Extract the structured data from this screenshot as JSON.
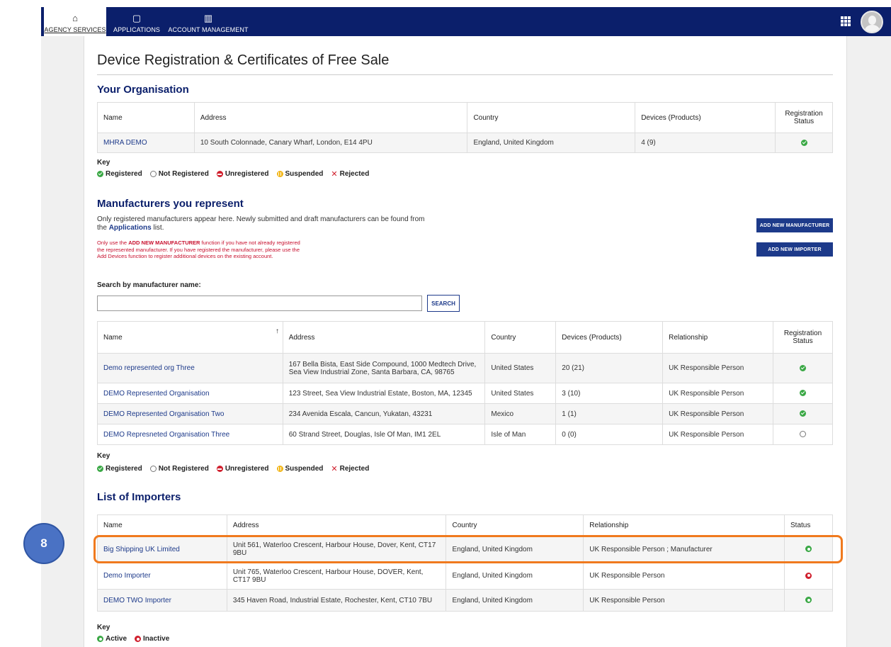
{
  "nav": {
    "items": [
      {
        "icon": "home-icon",
        "glyph": "⌂",
        "label": "AGENCY SERVICES"
      },
      {
        "icon": "document-icon",
        "glyph": "▢",
        "label": "APPLICATIONS"
      },
      {
        "icon": "building-icon",
        "glyph": "▥",
        "label": "ACCOUNT MANAGEMENT"
      }
    ],
    "apps_icon": "grid-icon",
    "avatar_icon": "user-avatar-icon"
  },
  "page": {
    "title": "Device Registration & Certificates of Free Sale"
  },
  "your_org": {
    "heading": "Your Organisation",
    "columns": [
      "Name",
      "Address",
      "Country",
      "Devices (Products)",
      "Registration Status"
    ],
    "rows": [
      {
        "name": "MHRA DEMO",
        "address": "10 South Colonnade, Canary Wharf, London, E14 4PU",
        "country": "England, United Kingdom",
        "devices": "4 (9)",
        "status": "registered"
      }
    ]
  },
  "key_registration": {
    "title": "Key",
    "items": [
      "Registered",
      "Not Registered",
      "Unregistered",
      "Suspended",
      "Rejected"
    ]
  },
  "manufacturers": {
    "heading": "Manufacturers you represent",
    "desc_line1": "Only registered manufacturers appear here. Newly submitted and draft manufacturers can be found from",
    "desc_line2_pre": "the ",
    "desc_line2_link": "Applications",
    "desc_line2_post": " list.",
    "warn_pre": "Only use the ",
    "warn_bold": "ADD NEW MANUFACTURER",
    "warn_post": " function if you have not already registered the represented manufacturer. If you have registered the manufacturer, please use the Add Devices function to register additional devices on the existing account.",
    "add_manufacturer_label": "ADD NEW MANUFACTURER",
    "add_importer_label": "ADD NEW IMPORTER",
    "search_label": "Search by manufacturer name:",
    "search_value": "",
    "search_button": "SEARCH",
    "sort_arrow": "↑",
    "columns": [
      "Name",
      "Address",
      "Country",
      "Devices (Products)",
      "Relationship",
      "Registration Status"
    ],
    "rows": [
      {
        "name": "Demo represented org Three",
        "address": "167 Bella Bista, East Side Compound, 1000 Medtech Drive, Sea View Industrial Zone, Santa Barbara, CA, 98765",
        "country": "United States",
        "devices": "20 (21)",
        "relationship": "UK Responsible Person",
        "status": "registered"
      },
      {
        "name": "DEMO Represented Organisation",
        "address": "123 Street, Sea View Industrial Estate, Boston, MA, 12345",
        "country": "United States",
        "devices": "3 (10)",
        "relationship": "UK Responsible Person",
        "status": "registered"
      },
      {
        "name": "DEMO Represented Organisation Two",
        "address": "234 Avenida Escala, Cancun, Yukatan, 43231",
        "country": "Mexico",
        "devices": "1 (1)",
        "relationship": "UK Responsible Person",
        "status": "registered"
      },
      {
        "name": "DEMO Represneted Organisation Three",
        "address": "60 Strand Street, Douglas, Isle Of Man, IM1 2EL",
        "country": "Isle of Man",
        "devices": "0 (0)",
        "relationship": "UK Responsible Person",
        "status": "not-registered"
      }
    ]
  },
  "importers": {
    "heading": "List of Importers",
    "columns": [
      "Name",
      "Address",
      "Country",
      "Relationship",
      "Status"
    ],
    "rows": [
      {
        "name": "Big Shipping UK Limited",
        "address": "Unit 561, Waterloo Crescent, Harbour House, Dover, Kent, CT17 9BU",
        "country": "England, United Kingdom",
        "relationship": "UK Responsible Person ; Manufacturer",
        "status": "active"
      },
      {
        "name": "Demo Importer",
        "address": "Unit 765, Waterloo Crescent, Harbour House, DOVER, Kent, CT17 9BU",
        "country": "England, United Kingdom",
        "relationship": "UK Responsible Person",
        "status": "inactive"
      },
      {
        "name": "DEMO TWO Importer",
        "address": "345 Haven Road, Industrial Estate, Rochester, Kent, CT10 7BU",
        "country": "England, United Kingdom",
        "relationship": "UK Responsible Person",
        "status": "active"
      }
    ]
  },
  "key_importer": {
    "title": "Key",
    "items": [
      "Active",
      "Inactive"
    ]
  },
  "annotation": {
    "step_number": "8",
    "highlight_color": "#f07a1e",
    "badge_color": "#4a72c4"
  },
  "colors": {
    "navbar": "#0b1f6b",
    "heading": "#0b1f6b",
    "link": "#1d3a8a",
    "registered": "#3aa845",
    "unregistered": "#d0202e",
    "suspended": "#f2b514",
    "warning_text": "#c8102e"
  }
}
